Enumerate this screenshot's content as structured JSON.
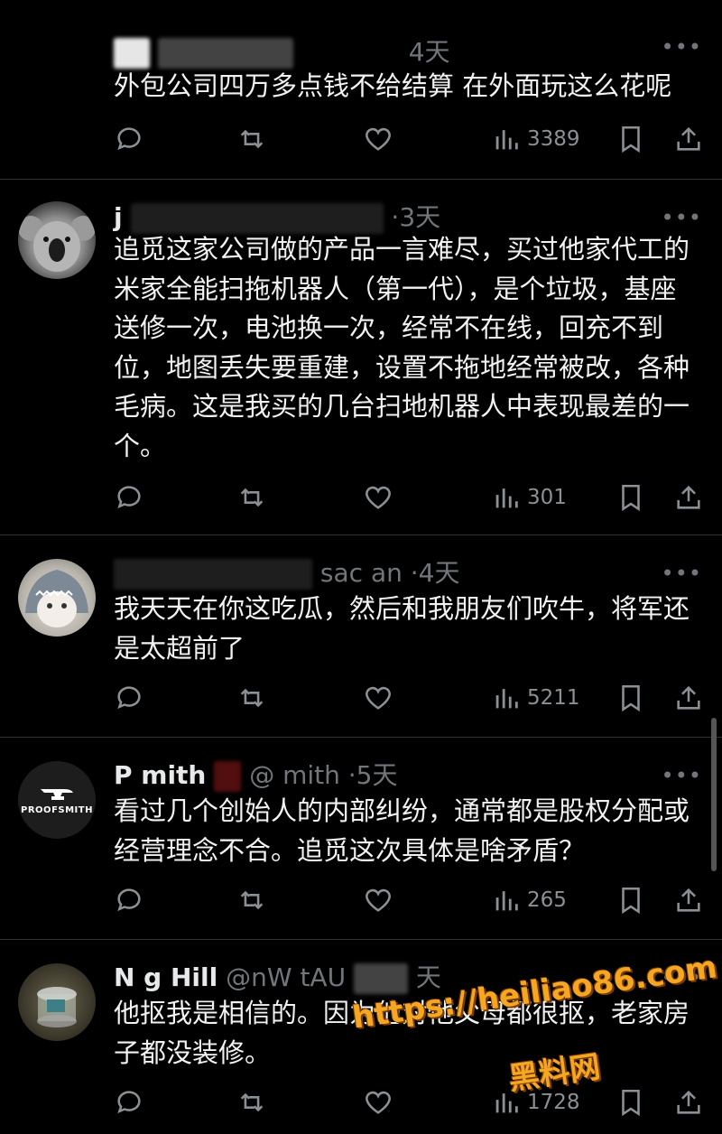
{
  "posts": [
    {
      "name": "",
      "handle": "",
      "time": "4天",
      "text": "外包公司四万多点钱不给结算 在外面玩这么花呢",
      "views": "3389"
    },
    {
      "name": "j",
      "handle": "",
      "time": "·3天",
      "text": "追觅这家公司做的产品一言难尽，买过他家代工的米家全能扫拖机器人（第一代），是个垃圾，基座送修一次，电池换一次，经常不在线，回充不到位，地图丢失要重建，设置不拖地经常被改，各种毛病。这是我买的几台扫地机器人中表现最差的一个。",
      "views": "301"
    },
    {
      "name": "",
      "handle": "sac        an",
      "time": "·4天",
      "text": "我天天在你这吃瓜，然后和我朋友们吹牛，将军还是太超前了",
      "views": "5211"
    },
    {
      "name": "P      mith",
      "handle": "@       mith",
      "time": "·5天",
      "avatar_text": "PROOFSMITH",
      "text": "看过几个创始人的内部纠纷，通常都是股权分配或经营理念不合。追觅这次具体是啥矛盾？",
      "views": "265"
    },
    {
      "name": "N     g Hill",
      "handle": "@nW       tAU",
      "time": "天",
      "text": "他抠我是相信的。因为他对他父母都很抠，老家房子都没装修。",
      "views": "1728"
    }
  ],
  "watermark": {
    "line1": "https://heiliao86.com",
    "line2": "黑料网"
  },
  "colors": {
    "background": "#000000",
    "text": "#e7e9ea",
    "muted": "#71767b",
    "watermark": "#f5a623"
  }
}
